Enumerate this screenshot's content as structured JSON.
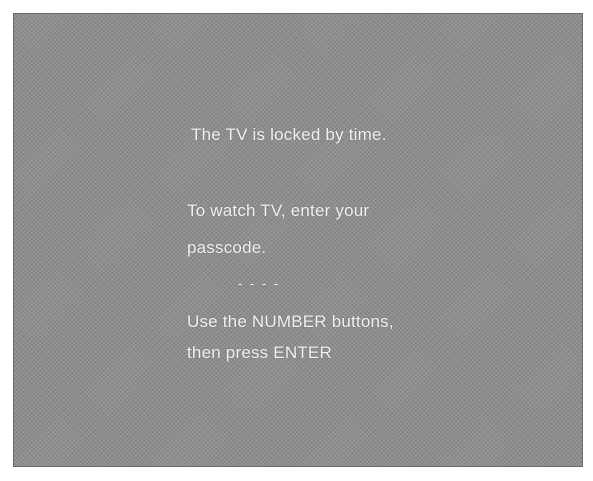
{
  "lock_screen": {
    "line1": "The TV is locked by time.",
    "line2": "To watch TV, enter your",
    "line3": "passcode.",
    "passcode_entry": "- - - -",
    "line4": "Use the NUMBER buttons,",
    "line5": "then press ENTER"
  }
}
